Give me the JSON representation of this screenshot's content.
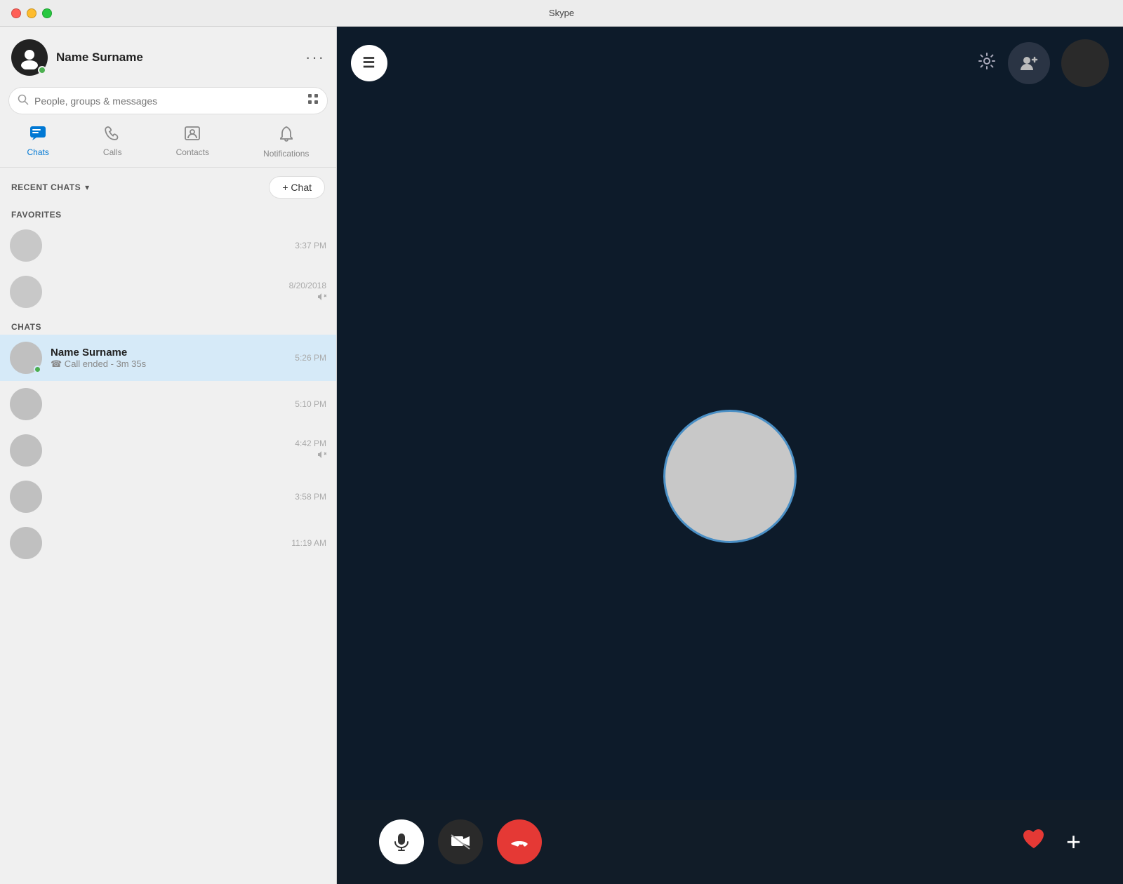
{
  "app": {
    "title": "Skype"
  },
  "titlebar": {
    "close_btn": "close",
    "min_btn": "minimize",
    "max_btn": "maximize"
  },
  "sidebar": {
    "profile": {
      "name": "Name Surname",
      "more_label": "···"
    },
    "search": {
      "placeholder": "People, groups & messages"
    },
    "nav_tabs": [
      {
        "id": "chats",
        "label": "Chats",
        "icon": "💬",
        "active": true
      },
      {
        "id": "calls",
        "label": "Calls",
        "icon": "📞",
        "active": false
      },
      {
        "id": "contacts",
        "label": "Contacts",
        "icon": "👤",
        "active": false
      },
      {
        "id": "notifications",
        "label": "Notifications",
        "icon": "🔔",
        "active": false
      }
    ],
    "recent_chats_label": "RECENT CHATS",
    "new_chat_label": "+ Chat",
    "favorites_label": "FAVORITES",
    "chats_label": "CHATS",
    "favorite_items": [
      {
        "id": "fav1",
        "time": "3:37 PM"
      },
      {
        "id": "fav2",
        "time": "8/20/2018",
        "muted": true
      }
    ],
    "chat_items": [
      {
        "id": "chat1",
        "name": "Name Surname",
        "preview": "☎ Call ended - 3m 35s",
        "time": "5:26 PM",
        "active": true,
        "online": true
      },
      {
        "id": "chat2",
        "name": "",
        "preview": "",
        "time": "5:10 PM",
        "active": false
      },
      {
        "id": "chat3",
        "name": "",
        "preview": "",
        "time": "4:42 PM",
        "active": false,
        "muted": true
      },
      {
        "id": "chat4",
        "name": "",
        "preview": "",
        "time": "3:58 PM",
        "active": false
      },
      {
        "id": "chat5",
        "name": "",
        "preview": "",
        "time": "11:19 AM",
        "active": false
      }
    ]
  },
  "call": {
    "menu_icon": "≡",
    "gear_icon": "⚙",
    "add_person_icon": "👤+",
    "mic_icon": "🎤",
    "end_call_icon": "📞",
    "heart_icon": "♥",
    "plus_icon": "+"
  }
}
